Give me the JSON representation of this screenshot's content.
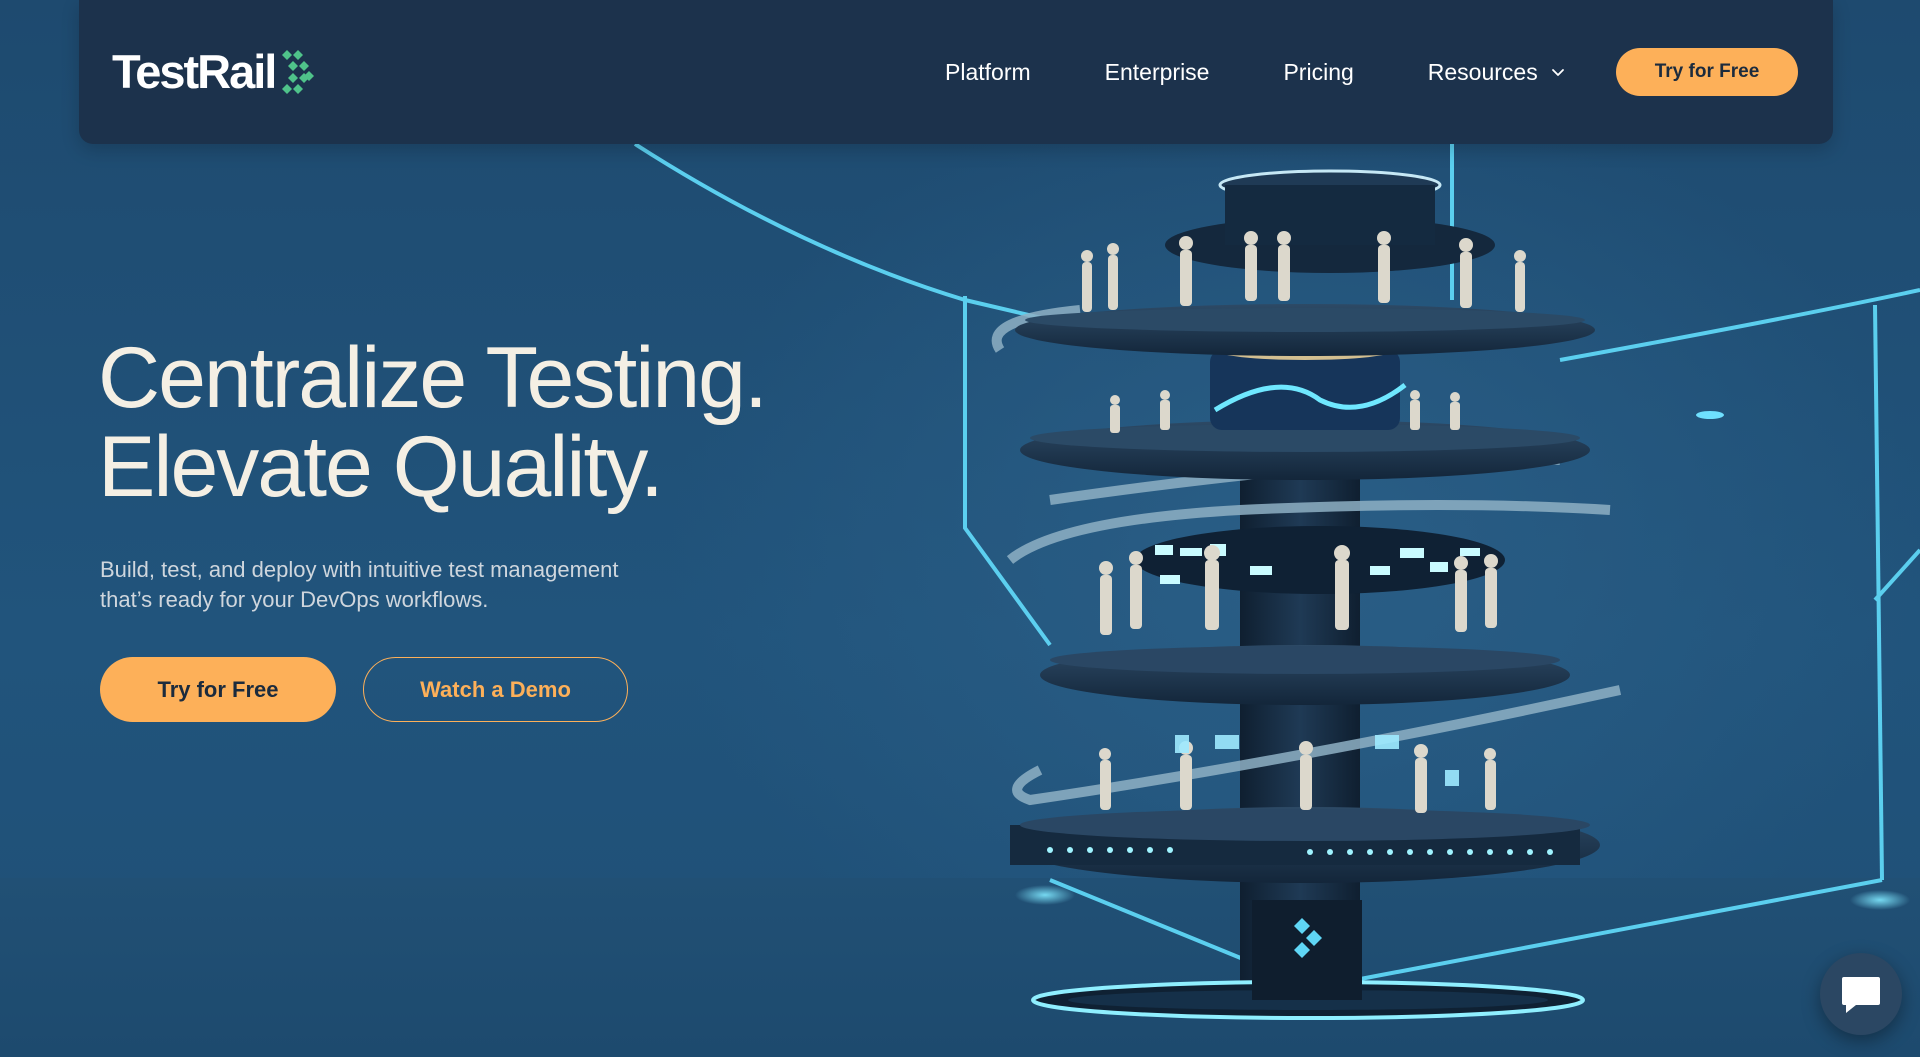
{
  "brand": {
    "name": "TestRail",
    "logo_icon": "testrail-chevron-logo",
    "accent": "#fdb059",
    "mark_color": "#4fc38a",
    "navbar_bg": "#1c324c"
  },
  "nav": {
    "items": [
      {
        "label": "Platform"
      },
      {
        "label": "Enterprise"
      },
      {
        "label": "Pricing"
      },
      {
        "label": "Resources",
        "icon": "chevron-down-icon"
      }
    ],
    "cta_label": "Try for Free"
  },
  "hero": {
    "headline_line1": "Centralize Testing.",
    "headline_line2": "Elevate Quality.",
    "sub_line1": "Build, test, and deploy with intuitive test management",
    "sub_line2": "that’s ready for your DevOps workflows.",
    "primary_label": "Try for Free",
    "secondary_label": "Watch a Demo",
    "illustration": "multi-level-testing-tower-illustration"
  },
  "chat": {
    "icon": "chat-bubble-icon"
  }
}
